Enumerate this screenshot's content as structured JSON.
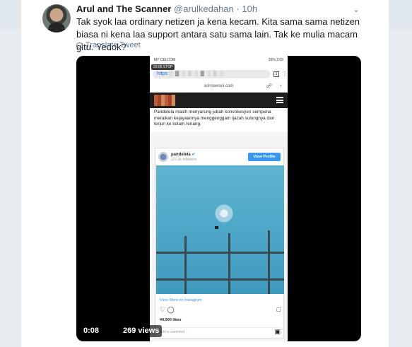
{
  "tweet": {
    "name": "Arul and The Scanner",
    "handle": "@arulkedahan",
    "separator": "·",
    "time": "10h",
    "text": "Tak syok laa ordinary netizen ja kena kecam. Kita sama sama netizen biasa ni kena laa support antara satu sama lain. Tak ke mulia macam gitu. Yedok?",
    "translate_label": "Translate Tweet"
  },
  "video": {
    "time": "0:08",
    "views": "269 views"
  },
  "phone": {
    "status_left": "MY CELCOM",
    "status_right": "26% 2:09",
    "rec_label": "20:05 STOP",
    "url_prefix": "https",
    "url_blur": "░ ▓ ░ ▒ ░ ▓ ░ ▒ ░",
    "domain": "asiroawani.com",
    "article_text": "Pandelela masih menyarung jubah konvokesyen sempena meraikan kejayaannya menggenggam ijazah sulungnya dan terjun ke kolam renang."
  },
  "instagram": {
    "username": "pandelela",
    "followers": "227.3k followers",
    "view_profile": "View Profile",
    "view_more": "View More on Instagram",
    "likes": "44,900 likes",
    "comment_placeholder": "Add a comment..."
  },
  "icons": {
    "caret": "chevron-down-icon",
    "translate": "globe-icon",
    "verified": "verified-badge-icon",
    "like": "heart-icon",
    "comment": "comment-icon",
    "save": "bookmark-icon",
    "instagram": "instagram-icon",
    "hamburger": "hamburger-menu-icon"
  },
  "colors": {
    "link_blue": "#3897f0",
    "page_bg": "#e6ecf0",
    "text_gray": "#657786"
  }
}
